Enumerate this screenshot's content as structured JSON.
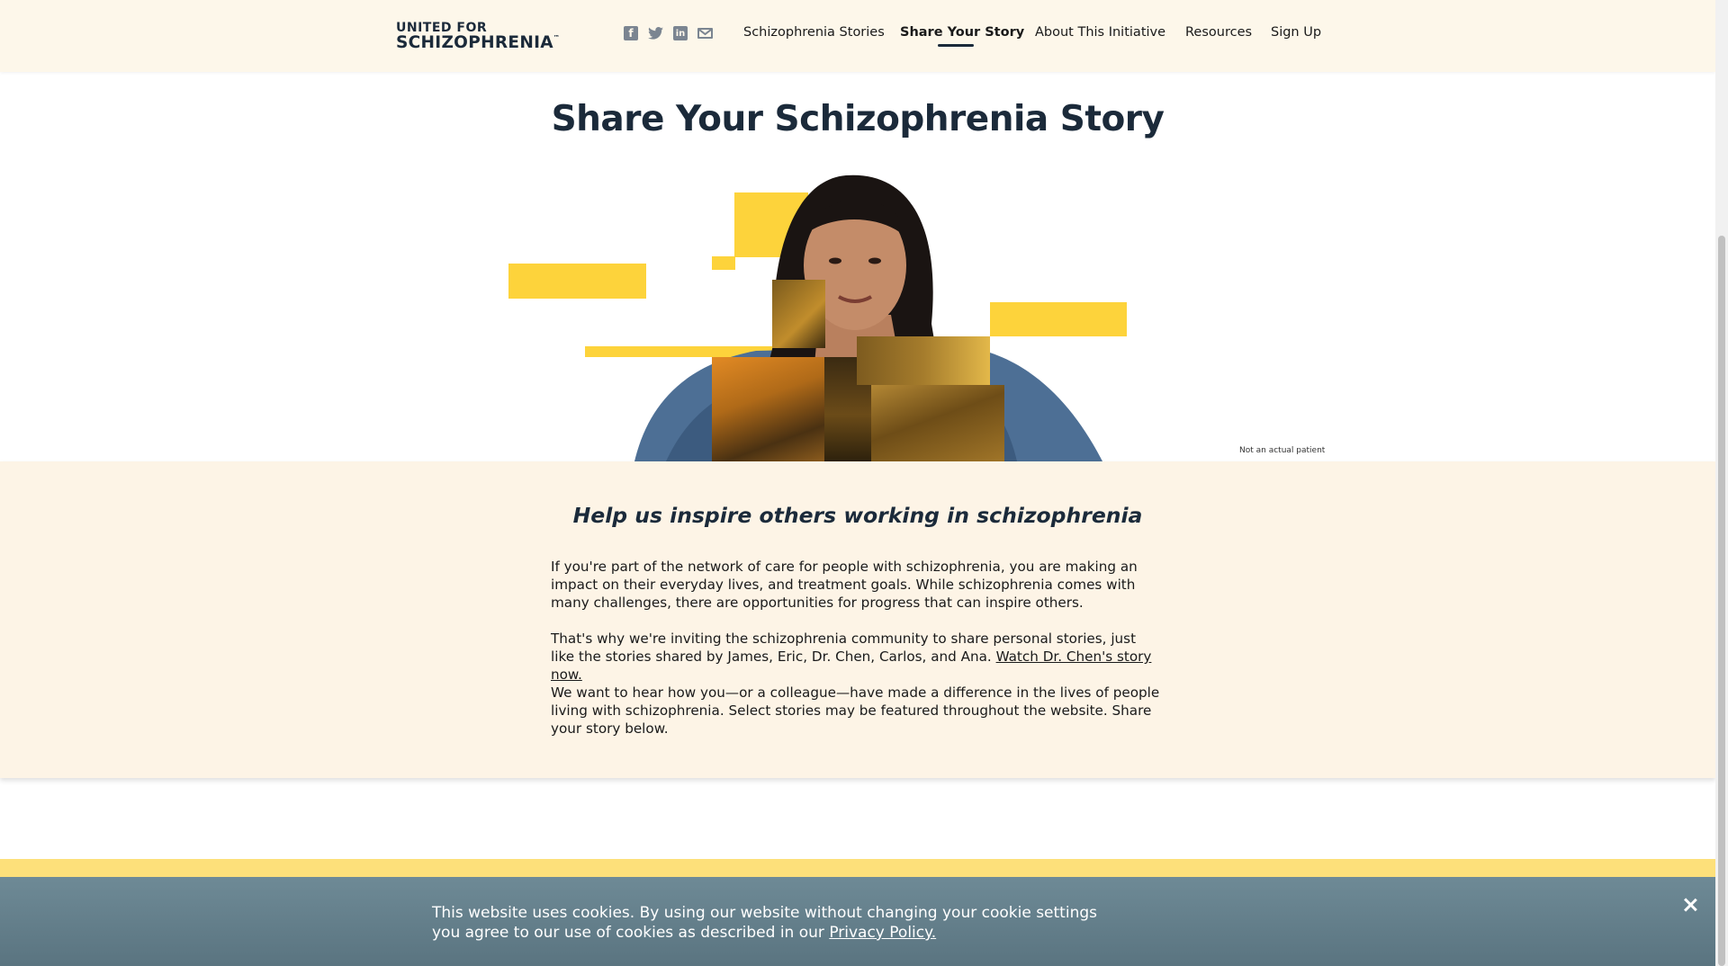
{
  "header": {
    "logo": {
      "line1": "UNITED FOR",
      "line2": "SCHIZOPHRENIA",
      "tm": "™"
    },
    "social": [
      {
        "name": "facebook-icon",
        "glyph": "f"
      },
      {
        "name": "twitter-icon"
      },
      {
        "name": "linkedin-icon",
        "glyph": "in"
      },
      {
        "name": "email-icon"
      }
    ],
    "nav": [
      {
        "label": "Schizophrenia Stories",
        "active": false
      },
      {
        "label": "Share Your Story",
        "active": true
      },
      {
        "label": "About This Initiative",
        "active": false
      },
      {
        "label": "Resources",
        "active": false
      },
      {
        "label": "Sign Up",
        "active": false
      }
    ]
  },
  "hero": {
    "title": "Share Your Schizophrenia Story",
    "disclaimer": "Not an actual patient"
  },
  "intro": {
    "subtitle": "Help us inspire others working in schizophrenia",
    "p1": "If you're part of the network of care for people with schizophrenia, you are making an impact on their everyday lives, and treatment goals. While schizophrenia comes with many challenges, there are opportunities for progress that can inspire others.",
    "p2_text": "That's why we're inviting the schizophrenia community to share personal stories, just like the stories shared by James, Eric, Dr. Chen, Carlos, and Ana. ",
    "p2_link": "Watch Dr. Chen's story now.",
    "p3": "We want to hear how you—or a colleague—have made a difference in the lives of people living with schizophrenia. Select stories may be featured throughout the website. Share your story below."
  },
  "cookie": {
    "text": "This website uses cookies. By using our website without changing your cookie settings you agree to our use of cookies as described in our ",
    "link": "Privacy Policy."
  },
  "colors": {
    "accent_yellow": "#fdd33b",
    "navy": "#1b2a3a",
    "cream": "#fdf4e6",
    "cookie_bg": "#6e8a96"
  }
}
